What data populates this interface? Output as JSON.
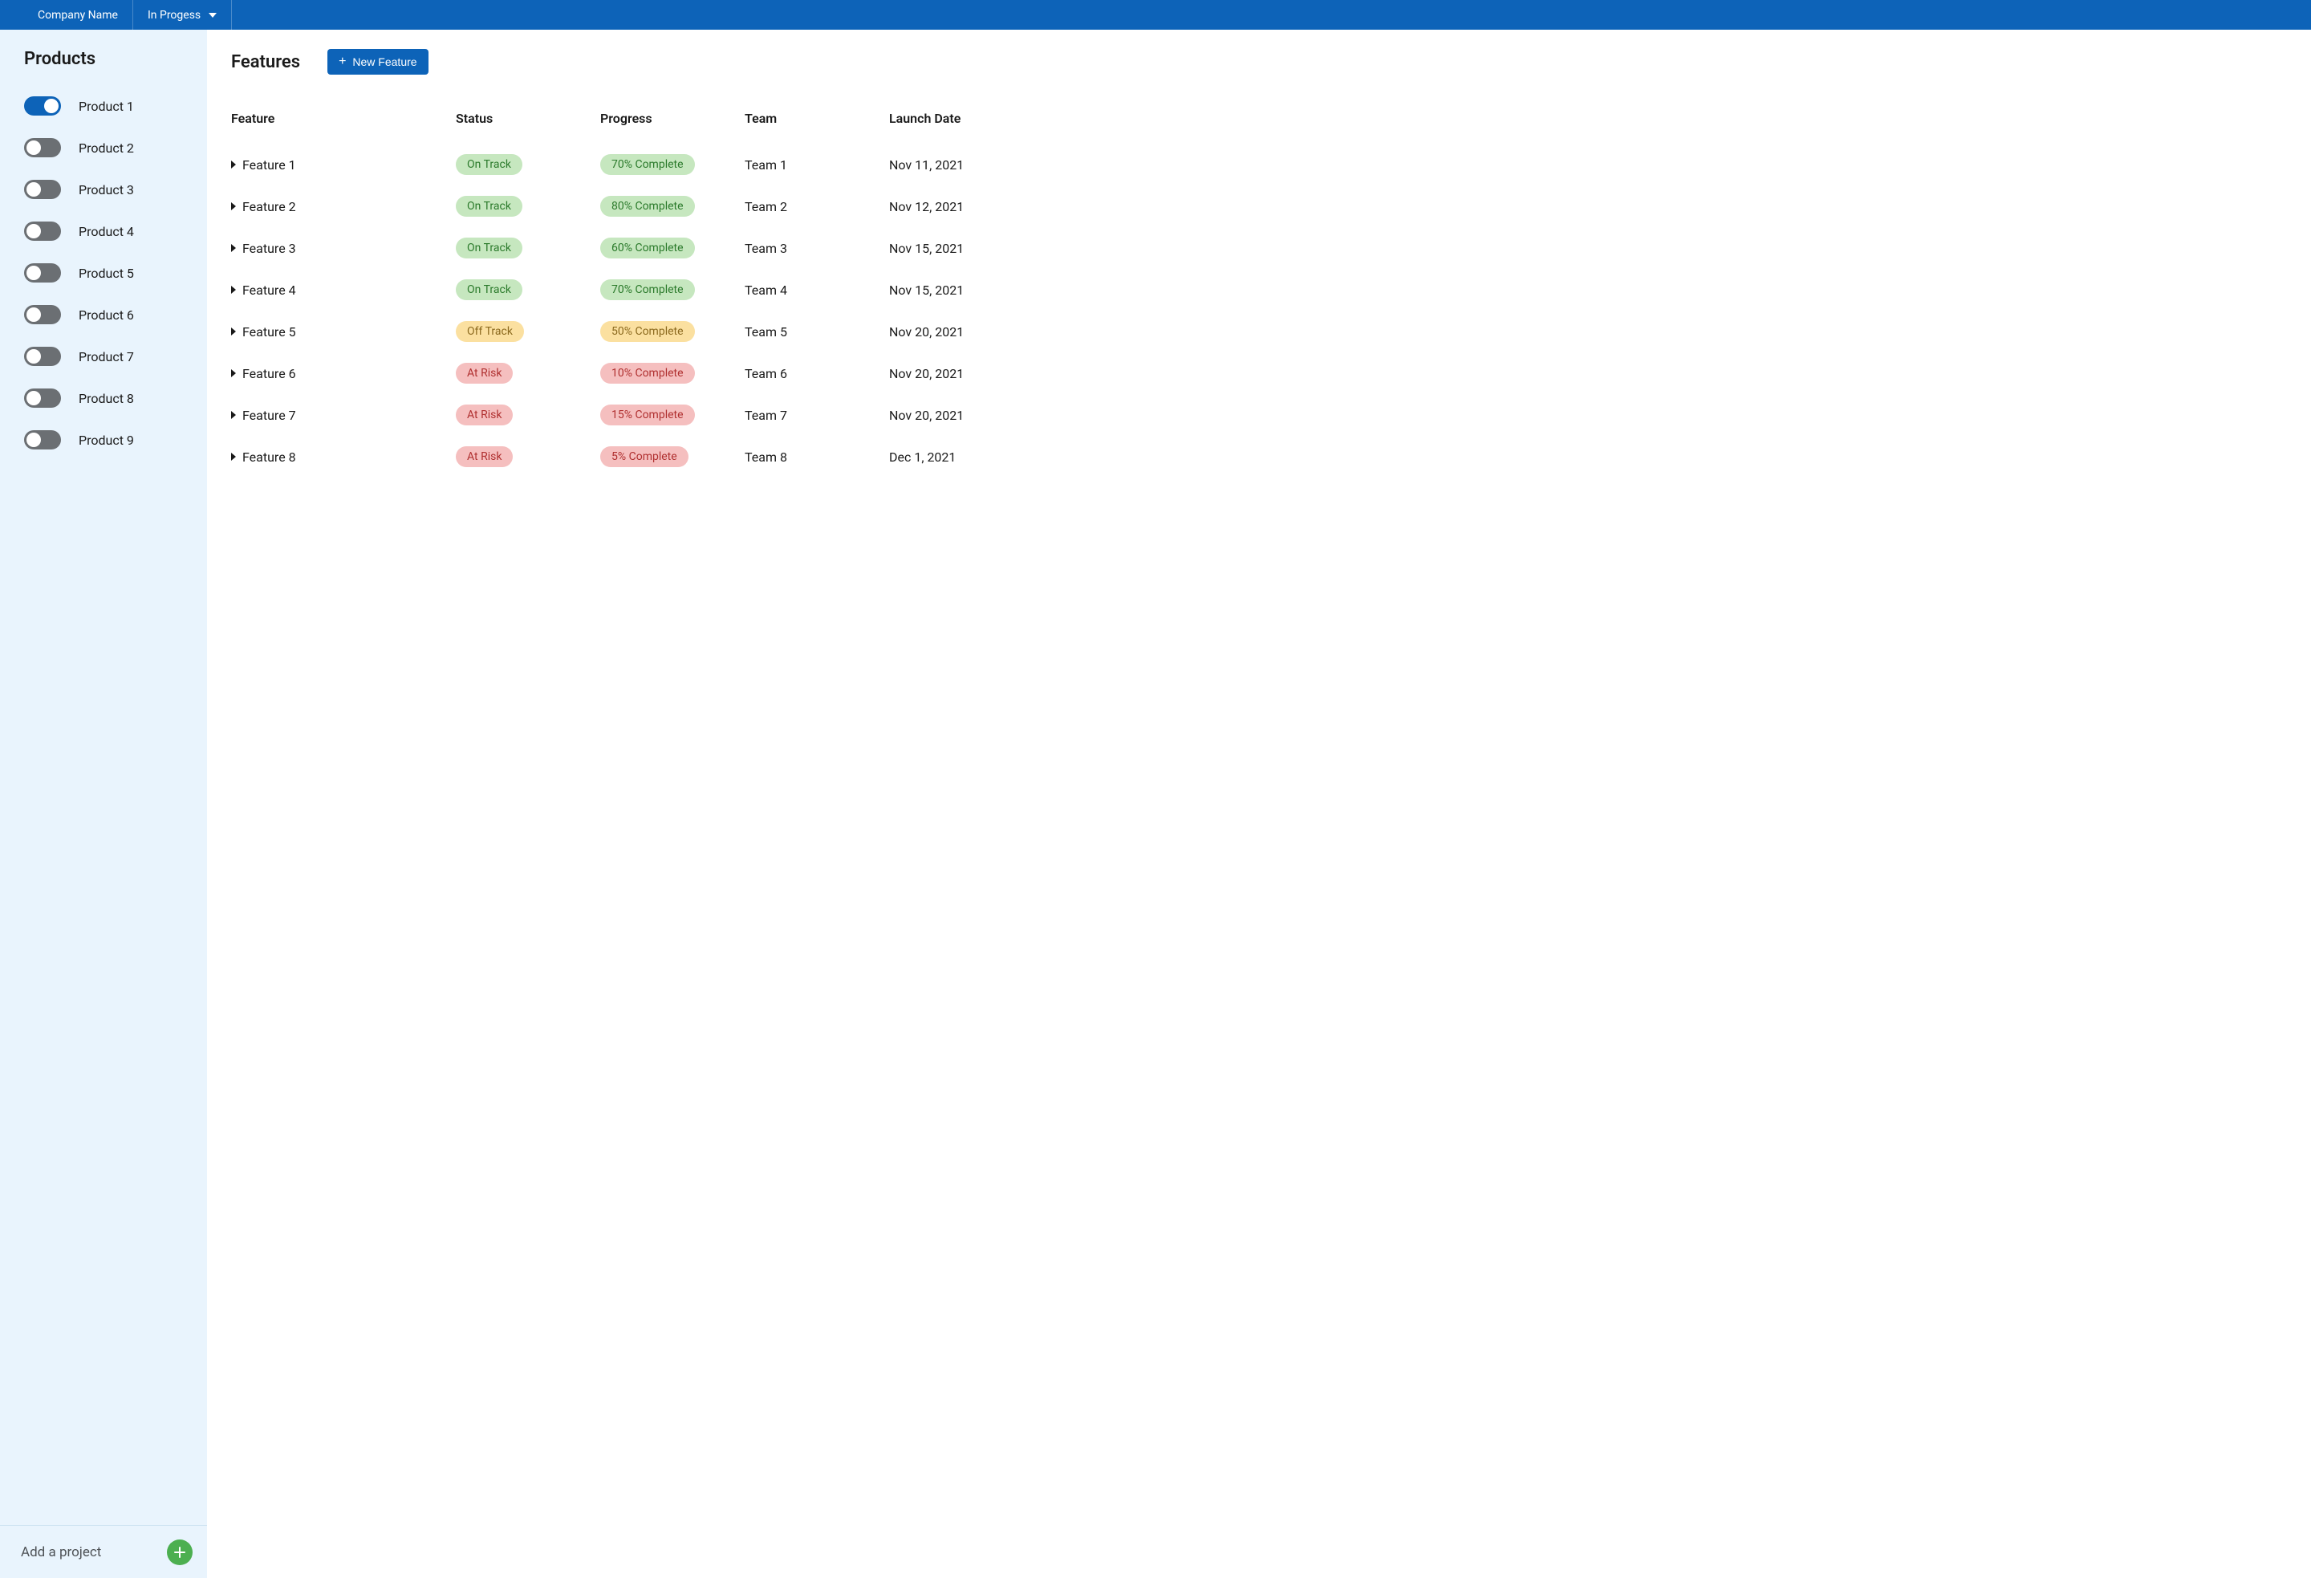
{
  "topbar": {
    "company": "Company Name",
    "status": "In Progess"
  },
  "sidebar": {
    "title": "Products",
    "products": [
      {
        "label": "Product 1",
        "on": true
      },
      {
        "label": "Product 2",
        "on": false
      },
      {
        "label": "Product 3",
        "on": false
      },
      {
        "label": "Product 4",
        "on": false
      },
      {
        "label": "Product 5",
        "on": false
      },
      {
        "label": "Product 6",
        "on": false
      },
      {
        "label": "Product 7",
        "on": false
      },
      {
        "label": "Product 8",
        "on": false
      },
      {
        "label": "Product 9",
        "on": false
      }
    ],
    "footer_label": "Add a project"
  },
  "main": {
    "title": "Features",
    "new_feature_button": "New Feature",
    "columns": {
      "feature": "Feature",
      "status": "Status",
      "progress": "Progress",
      "team": "Team",
      "launch": "Launch Date"
    },
    "rows": [
      {
        "feature": "Feature 1",
        "status": "On Track",
        "status_color": "green",
        "progress": "70% Complete",
        "progress_color": "green",
        "team": "Team 1",
        "launch": "Nov 11, 2021"
      },
      {
        "feature": "Feature 2",
        "status": "On Track",
        "status_color": "green",
        "progress": "80% Complete",
        "progress_color": "green",
        "team": "Team 2",
        "launch": "Nov 12, 2021"
      },
      {
        "feature": "Feature 3",
        "status": "On Track",
        "status_color": "green",
        "progress": "60% Complete",
        "progress_color": "green",
        "team": "Team 3",
        "launch": "Nov 15, 2021"
      },
      {
        "feature": "Feature 4",
        "status": "On Track",
        "status_color": "green",
        "progress": "70% Complete",
        "progress_color": "green",
        "team": "Team 4",
        "launch": "Nov 15, 2021"
      },
      {
        "feature": "Feature 5",
        "status": "Off Track",
        "status_color": "yellow",
        "progress": "50% Complete",
        "progress_color": "yellow",
        "team": "Team 5",
        "launch": "Nov 20, 2021"
      },
      {
        "feature": "Feature 6",
        "status": "At Risk",
        "status_color": "red",
        "progress": "10% Complete",
        "progress_color": "red",
        "team": "Team 6",
        "launch": "Nov 20, 2021"
      },
      {
        "feature": "Feature 7",
        "status": "At Risk",
        "status_color": "red",
        "progress": "15% Complete",
        "progress_color": "red",
        "team": "Team 7",
        "launch": "Nov 20, 2021"
      },
      {
        "feature": "Feature 8",
        "status": "At Risk",
        "status_color": "red",
        "progress": "5% Complete",
        "progress_color": "red",
        "team": "Team 8",
        "launch": "Dec 1, 2021"
      }
    ]
  }
}
